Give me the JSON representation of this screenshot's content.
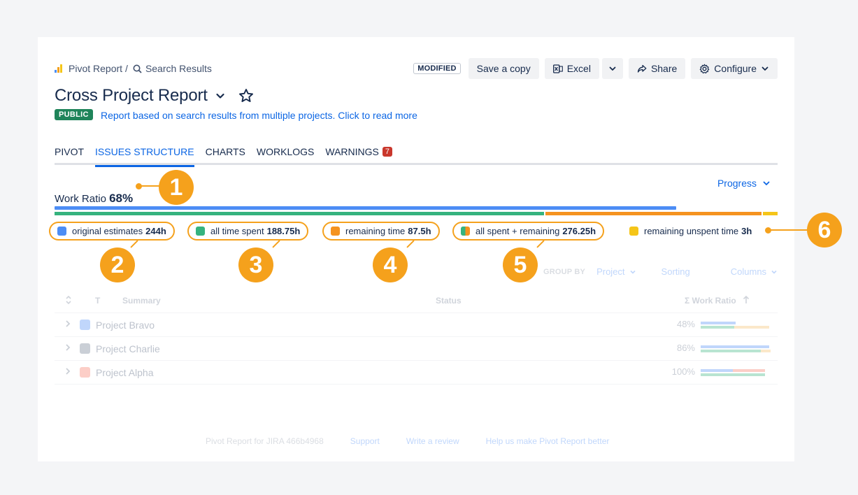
{
  "breadcrumb": {
    "app": "Pivot Report",
    "separator": "/",
    "current": "Search Results"
  },
  "toolbar": {
    "modified": "MODIFIED",
    "save_copy": "Save a copy",
    "excel": "Excel",
    "share": "Share",
    "configure": "Configure"
  },
  "report": {
    "title": "Cross Project Report",
    "visibility": "PUBLIC",
    "description": "Report based on search results from multiple projects. Click to read more"
  },
  "tabs": [
    {
      "label": "PIVOT",
      "active": false
    },
    {
      "label": "ISSUES STRUCTURE",
      "active": true
    },
    {
      "label": "CHARTS",
      "active": false
    },
    {
      "label": "WORKLOGS",
      "active": false
    },
    {
      "label": "WARNINGS",
      "active": false,
      "badge": "7"
    }
  ],
  "progress_selector": "Progress",
  "work_ratio": {
    "label": "Work Ratio",
    "value": "68%",
    "estimate_fraction": 0.86,
    "spent_fraction": 0.68,
    "remaining_fraction": 0.3,
    "unspent_fraction": 0.02
  },
  "legend": [
    {
      "label": "original estimates",
      "value": "244h",
      "color": "#4c8df5"
    },
    {
      "label": "all time spent",
      "value": "188.75h",
      "color": "#36b37e"
    },
    {
      "label": "remaining time",
      "value": "87.5h",
      "color": "#f5931f"
    },
    {
      "label": "all spent + remaining",
      "value": "276.25h",
      "color": "#36b37e",
      "color2": "#f5931f"
    },
    {
      "label": "remaining unspent time",
      "value": "3h",
      "color": "#f5c518"
    }
  ],
  "callouts": [
    "1",
    "2",
    "3",
    "4",
    "5",
    "6"
  ],
  "callout_color": "#f5a11c",
  "group_by": {
    "label": "GROUP BY",
    "value": "Project",
    "sorting": "Sorting",
    "columns": "Columns"
  },
  "table": {
    "headers": {
      "type": "T",
      "summary": "Summary",
      "status": "Status",
      "work_ratio": "Σ Work Ratio"
    },
    "rows": [
      {
        "name": "Project Bravo",
        "pct": "48%",
        "icon_color": "#4c8df5",
        "estimate": 0.5,
        "spent": 0.48,
        "remaining": 0.5
      },
      {
        "name": "Project Charlie",
        "pct": "86%",
        "icon_color": "#6b778c",
        "estimate": 0.98,
        "spent": 0.86,
        "remaining": 0.14
      },
      {
        "name": "Project Alpha",
        "pct": "100%",
        "icon_color": "#f87462",
        "estimate": 0.46,
        "spent": 0.92,
        "remaining": 0.0
      }
    ]
  },
  "footer": {
    "version": "Pivot Report for JIRA 466b4968",
    "support": "Support",
    "review": "Write a review",
    "help": "Help us make Pivot Report better"
  }
}
